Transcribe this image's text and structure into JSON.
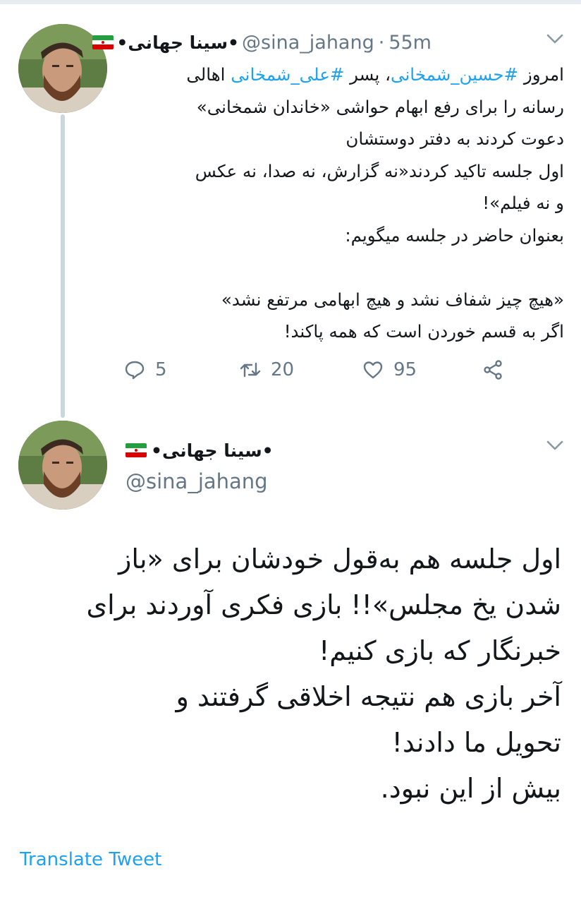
{
  "tweet1": {
    "author_name": "•سینا جهانی•",
    "author_handle": "@sina_jahang",
    "separator": "·",
    "time": "55m",
    "body": {
      "line1_pre": "امروز ",
      "line1_tag1": "#حسین_شمخانی",
      "line1_mid": "، پسر ",
      "line1_tag2": "#علی_شمخانی",
      "line1_post": " اهالی",
      "line2": "رسانه را برای رفع ابهام حواشی «خاندان شمخانی»",
      "line3": "دعوت کردند به دفتر دوستشان",
      "line4": "اول جلسه تاکید کردند«نه گزارش، نه صدا، نه عکس",
      "line5": "و نه فیلم»!",
      "line6": "بعنوان حاضر در جلسه میگویم:",
      "line7": "«هیچ چیز شفاف نشد و هیچ ابهامی مرتفع نشد»",
      "line8": "اگر به قسم خوردن است که همه پاکند!"
    },
    "reply_count": "5",
    "retweet_count": "20",
    "like_count": "95"
  },
  "tweet2": {
    "author_name": "•سینا جهانی•",
    "author_handle": "@sina_jahang",
    "body": {
      "line1": "اول جلسه هم به‌قول خودشان برای «باز",
      "line2": "شدن یخ مجلس»!! بازی فکری آوردند برای",
      "line3": "خبرنگار که بازی کنیم!",
      "line4": "آخر بازی هم نتیجه اخلاقی گرفتند و",
      "line5": "تحویل ما دادند!",
      "line6": "بیش از این نبود."
    },
    "translate_label": "Translate Tweet"
  },
  "colors": {
    "accent": "#1da1f2",
    "secondary_text": "#657786",
    "thread_line": "#ccd6dd"
  },
  "icons": [
    "avatar-photo",
    "iran-flag-emoji",
    "chevron-down-icon",
    "reply-icon",
    "retweet-icon",
    "like-icon",
    "share-icon"
  ]
}
